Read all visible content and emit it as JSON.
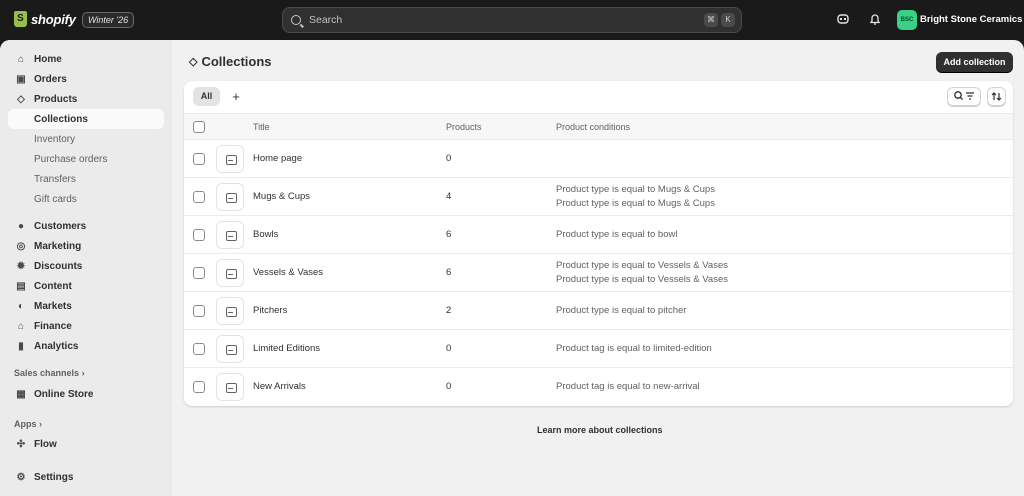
{
  "topbar": {
    "logo_text": "shopify",
    "edition": "Winter '26",
    "search_placeholder": "Search",
    "shortcut_1": "⌘",
    "shortcut_2": "K",
    "store_initials": "BSC",
    "store_name": "Bright Stone Ceramics"
  },
  "sidebar": {
    "home": "Home",
    "orders": "Orders",
    "products": "Products",
    "collections": "Collections",
    "inventory": "Inventory",
    "purchase_orders": "Purchase orders",
    "transfers": "Transfers",
    "gift_cards": "Gift cards",
    "customers": "Customers",
    "marketing": "Marketing",
    "discounts": "Discounts",
    "content": "Content",
    "markets": "Markets",
    "finance": "Finance",
    "analytics": "Analytics",
    "sales_channels": "Sales channels",
    "online_store": "Online Store",
    "apps": "Apps",
    "flow": "Flow",
    "settings": "Settings"
  },
  "page": {
    "title": "Collections",
    "add_button": "Add collection",
    "tab_all": "All",
    "tab_add": "+",
    "learn_more": "Learn more about collections"
  },
  "table": {
    "headers": {
      "title": "Title",
      "products": "Products",
      "conditions": "Product conditions"
    },
    "rows": [
      {
        "title": "Home page",
        "products": "0",
        "conditions": []
      },
      {
        "title": "Mugs & Cups",
        "products": "4",
        "conditions": [
          "Product type is equal to Mugs & Cups",
          "Product type is equal to Mugs & Cups"
        ]
      },
      {
        "title": "Bowls",
        "products": "6",
        "conditions": [
          "Product type is equal to bowl"
        ]
      },
      {
        "title": "Vessels & Vases",
        "products": "6",
        "conditions": [
          "Product type is equal to Vessels & Vases",
          "Product type is equal to Vessels & Vases"
        ]
      },
      {
        "title": "Pitchers",
        "products": "2",
        "conditions": [
          "Product type is equal to pitcher"
        ]
      },
      {
        "title": "Limited Editions",
        "products": "0",
        "conditions": [
          "Product tag is equal to limited-edition"
        ]
      },
      {
        "title": "New Arrivals",
        "products": "0",
        "conditions": [
          "Product tag is equal to new-arrival"
        ]
      }
    ]
  },
  "colors": {
    "topbar": "#1a1a1a",
    "store_avatar": "#3ad086",
    "primary_button": "#303030"
  }
}
